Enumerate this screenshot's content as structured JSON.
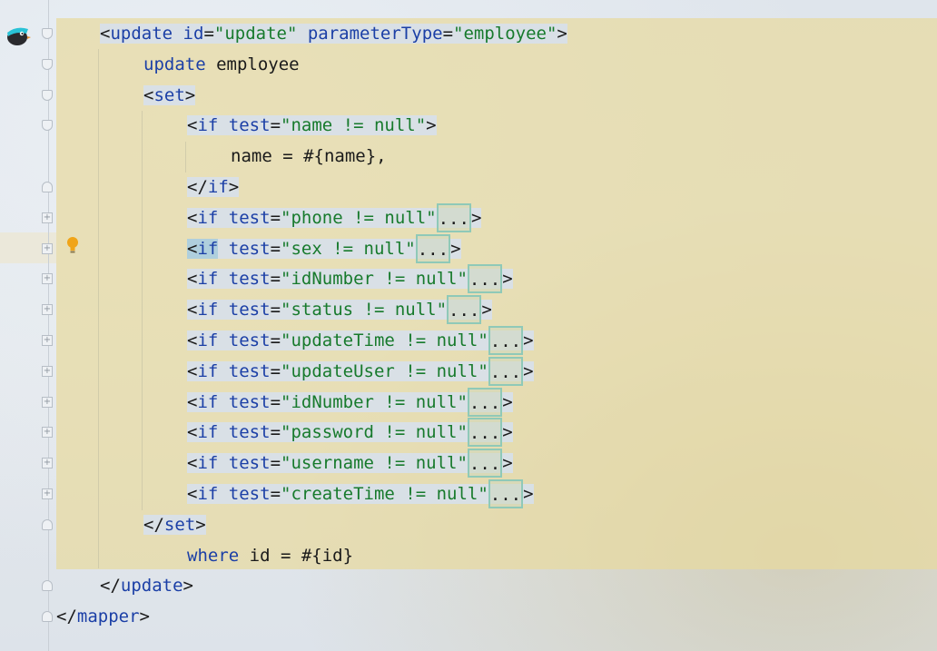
{
  "editor": {
    "lines": [
      {
        "parts": [
          [
            "punct",
            "<"
          ],
          [
            "tag",
            "update"
          ],
          [
            "punct",
            " "
          ],
          [
            "attr",
            "id"
          ],
          [
            "punct",
            "="
          ],
          [
            "str",
            "\"update\""
          ],
          [
            "punct",
            " "
          ],
          [
            "attr",
            "parameterType"
          ],
          [
            "punct",
            "="
          ],
          [
            "str",
            "\"employee\""
          ],
          [
            "punct",
            ">"
          ]
        ]
      },
      {
        "parts": [
          [
            "tag",
            "update"
          ],
          [
            "punct",
            " employee"
          ]
        ]
      },
      {
        "parts": [
          [
            "punct",
            "<"
          ],
          [
            "tag",
            "set"
          ],
          [
            "punct",
            ">"
          ]
        ]
      },
      {
        "parts": [
          [
            "punct",
            "<"
          ],
          [
            "tag",
            "if"
          ],
          [
            "punct",
            " "
          ],
          [
            "attr",
            "test"
          ],
          [
            "punct",
            "="
          ],
          [
            "str",
            "\"name != null\""
          ],
          [
            "punct",
            ">"
          ]
        ]
      },
      {
        "parts": [
          [
            "punct",
            "name = #{name},"
          ]
        ]
      },
      {
        "parts": [
          [
            "punct",
            "</"
          ],
          [
            "tag",
            "if"
          ],
          [
            "punct",
            ">"
          ]
        ]
      },
      {
        "parts": [
          [
            "punct",
            "<"
          ],
          [
            "tag",
            "if"
          ],
          [
            "punct",
            " "
          ],
          [
            "attr",
            "test"
          ],
          [
            "punct",
            "="
          ],
          [
            "str",
            "\"phone != null\""
          ]
        ],
        "fold": "...",
        "end": ">"
      },
      {
        "parts": [
          [
            "caret",
            "<if"
          ],
          [
            "punct",
            " "
          ],
          [
            "attr",
            "test"
          ],
          [
            "punct",
            "="
          ],
          [
            "str",
            "\"sex != null\""
          ]
        ],
        "fold": "...",
        "end": ">"
      },
      {
        "parts": [
          [
            "punct",
            "<"
          ],
          [
            "tag",
            "if"
          ],
          [
            "punct",
            " "
          ],
          [
            "attr",
            "test"
          ],
          [
            "punct",
            "="
          ],
          [
            "str",
            "\"idNumber != null\""
          ]
        ],
        "fold": "...",
        "end": ">"
      },
      {
        "parts": [
          [
            "punct",
            "<"
          ],
          [
            "tag",
            "if"
          ],
          [
            "punct",
            " "
          ],
          [
            "attr",
            "test"
          ],
          [
            "punct",
            "="
          ],
          [
            "str",
            "\"status != null\""
          ]
        ],
        "fold": "...",
        "end": ">"
      },
      {
        "parts": [
          [
            "punct",
            "<"
          ],
          [
            "tag",
            "if"
          ],
          [
            "punct",
            " "
          ],
          [
            "attr",
            "test"
          ],
          [
            "punct",
            "="
          ],
          [
            "str",
            "\"updateTime != null\""
          ]
        ],
        "fold": "...",
        "end": ">"
      },
      {
        "parts": [
          [
            "punct",
            "<"
          ],
          [
            "tag",
            "if"
          ],
          [
            "punct",
            " "
          ],
          [
            "attr",
            "test"
          ],
          [
            "punct",
            "="
          ],
          [
            "str",
            "\"updateUser != null\""
          ]
        ],
        "fold": "...",
        "end": ">"
      },
      {
        "parts": [
          [
            "punct",
            "<"
          ],
          [
            "tag",
            "if"
          ],
          [
            "punct",
            " "
          ],
          [
            "attr",
            "test"
          ],
          [
            "punct",
            "="
          ],
          [
            "str",
            "\"idNumber != null\""
          ]
        ],
        "fold": "...",
        "end": ">"
      },
      {
        "parts": [
          [
            "punct",
            "<"
          ],
          [
            "tag",
            "if"
          ],
          [
            "punct",
            " "
          ],
          [
            "attr",
            "test"
          ],
          [
            "punct",
            "="
          ],
          [
            "str",
            "\"password != null\""
          ]
        ],
        "fold": "...",
        "end": ">"
      },
      {
        "parts": [
          [
            "punct",
            "<"
          ],
          [
            "tag",
            "if"
          ],
          [
            "punct",
            " "
          ],
          [
            "attr",
            "test"
          ],
          [
            "punct",
            "="
          ],
          [
            "str",
            "\"username != null\""
          ]
        ],
        "fold": "...",
        "end": ">"
      },
      {
        "parts": [
          [
            "punct",
            "<"
          ],
          [
            "tag",
            "if"
          ],
          [
            "punct",
            " "
          ],
          [
            "attr",
            "test"
          ],
          [
            "punct",
            "="
          ],
          [
            "str",
            "\"createTime != null\""
          ]
        ],
        "fold": "...",
        "end": ">"
      },
      {
        "parts": [
          [
            "punct",
            "</"
          ],
          [
            "tag",
            "set"
          ],
          [
            "punct",
            ">"
          ]
        ]
      },
      {
        "parts": [
          [
            "tag",
            "where"
          ],
          [
            "punct",
            " id = #{id}"
          ]
        ]
      },
      {
        "parts": [
          [
            "punct",
            "</"
          ],
          [
            "tag",
            "update"
          ],
          [
            "punct",
            ">"
          ]
        ]
      },
      {
        "parts": [
          [
            "punct",
            "</"
          ],
          [
            "tag",
            "mapper"
          ],
          [
            "punct",
            ">"
          ]
        ]
      }
    ]
  },
  "icons": {
    "gutter_fold_open": "fold-open-icon",
    "gutter_fold_closed": "fold-expand-icon",
    "gutter_fold_end": "fold-end-icon",
    "intention": "lightbulb-icon",
    "plugin": "bird-avatar-icon"
  },
  "colors": {
    "tag": "#1b3fa6",
    "string": "#177a2c",
    "text": "#1a1a1a",
    "highlight_block": "#e8daa0",
    "fold_border": "#8fc9b8",
    "bulb": "#f0a418"
  }
}
